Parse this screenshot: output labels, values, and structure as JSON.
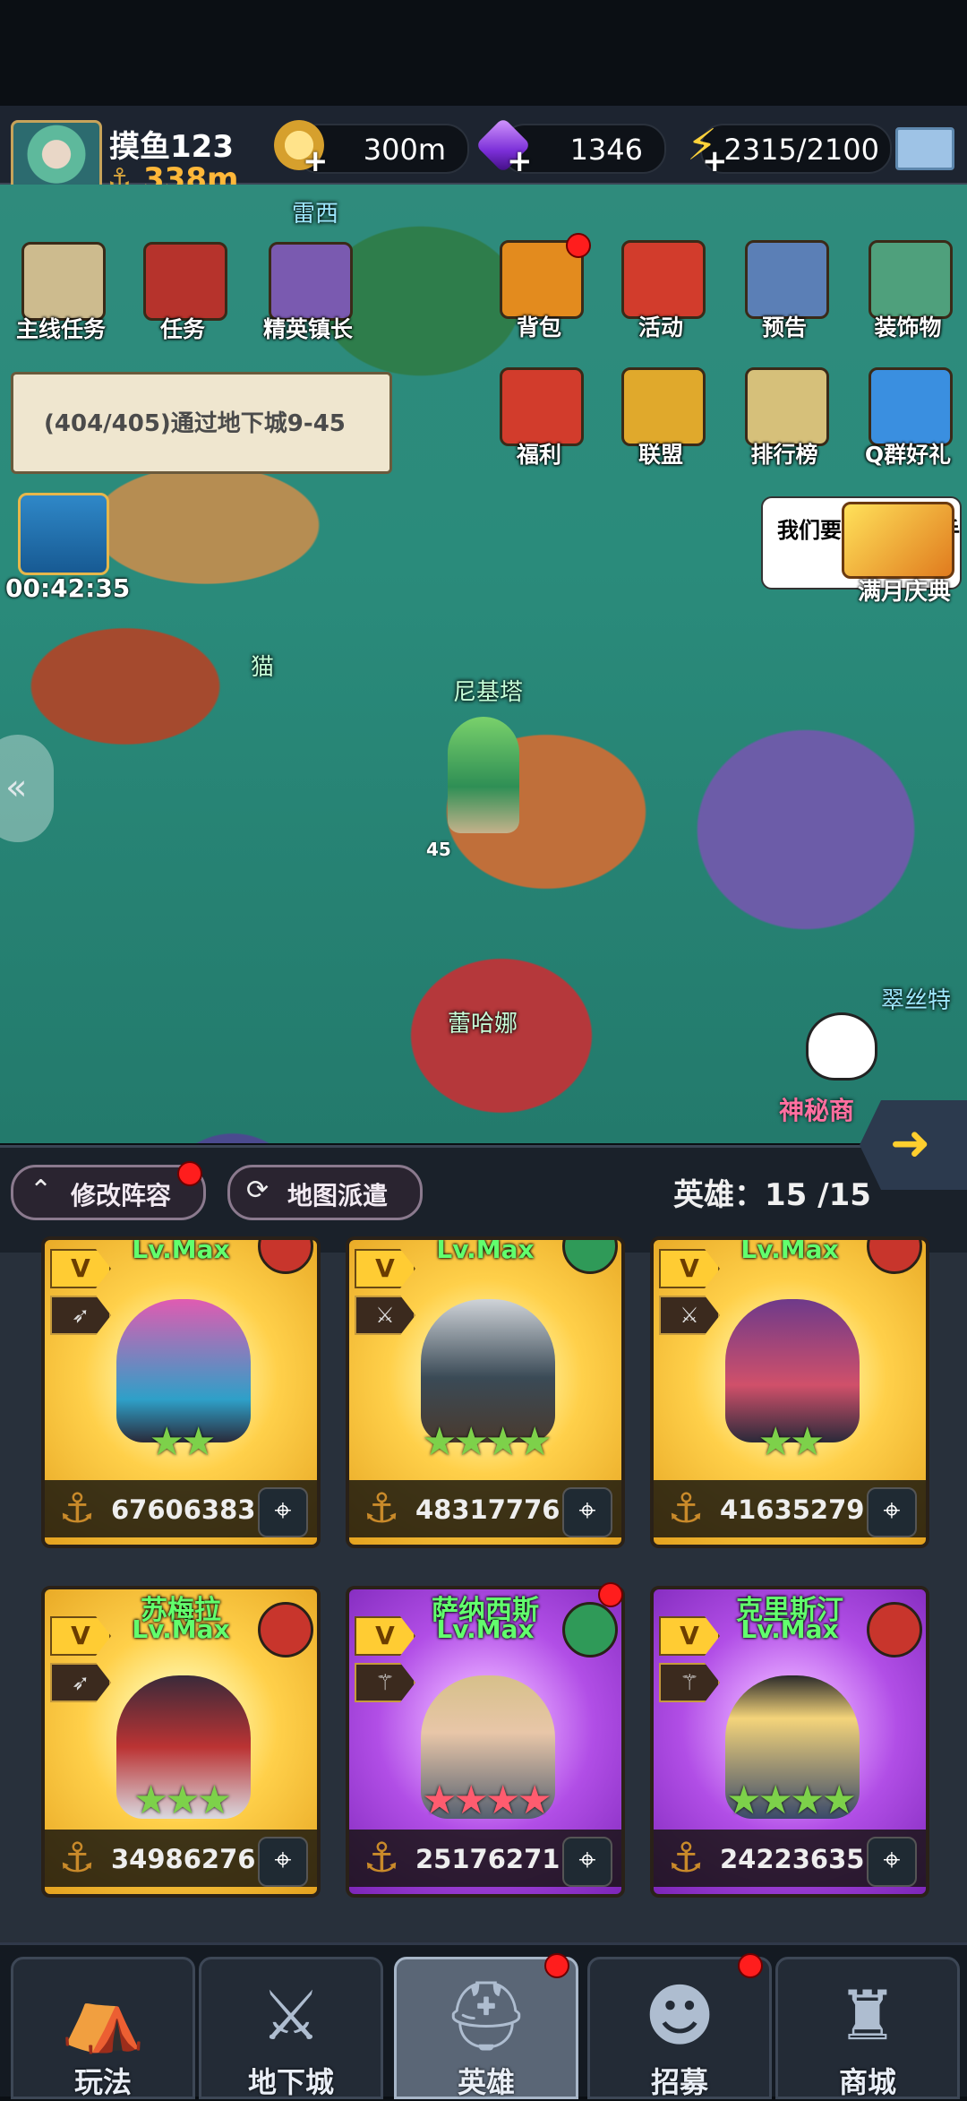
{
  "player": {
    "name": "摸鱼123",
    "power": "338m"
  },
  "resources": {
    "gold": "300m",
    "gems": "1346",
    "energy": "2315/2100"
  },
  "map": {
    "labels": {
      "top_area": "雷西",
      "cat": "猫",
      "nikita": "尼基塔",
      "leihana": "蕾哈娜",
      "cuisite": "翠丝特",
      "level_marker": "45",
      "mystic_shop": "神秘商"
    },
    "left_buttons": [
      {
        "label": "主线任务",
        "icon": "scroll-icon",
        "color": "#cdbb8e"
      },
      {
        "label": "任务",
        "icon": "book-icon",
        "color": "#b6332c"
      },
      {
        "label": "精英镇长",
        "icon": "mayor-icon",
        "color": "#7a5ab0"
      }
    ],
    "right_buttons_row1": [
      {
        "label": "背包",
        "icon": "backpack-icon",
        "color": "#e38b1e",
        "badge": true
      },
      {
        "label": "活动",
        "icon": "shield-icon",
        "color": "#d23c2c",
        "badge": false
      },
      {
        "label": "预告",
        "icon": "open-book-icon",
        "color": "#5b7fb6",
        "badge": false
      },
      {
        "label": "装饰物",
        "icon": "flower-icon",
        "color": "#4fa07c",
        "badge": false
      }
    ],
    "right_buttons_row2": [
      {
        "label": "福利",
        "icon": "gift-shield-icon",
        "color": "#d23c2c"
      },
      {
        "label": "联盟",
        "icon": "fist-icon",
        "color": "#e0a92c"
      },
      {
        "label": "排行榜",
        "icon": "trophy-icon",
        "color": "#d6c07a"
      },
      {
        "label": "Q群好礼",
        "icon": "chat-gift-icon",
        "color": "#3a8fe0"
      }
    ],
    "quest_text": "(404/405)通过地下城9-45",
    "chest_timer": "00:42:35",
    "speech_bubble": "我们要法",
    "bubble_tail": "手",
    "event_label": "满月庆典"
  },
  "midbar": {
    "edit_lineup": "修改阵容",
    "map_dispatch": "地图派遣",
    "hero_count": "英雄：15 /15"
  },
  "heroes": [
    {
      "name": "",
      "level": "Lv.Max",
      "power": "67606383",
      "rarity": "gold",
      "class": "bow",
      "element_color": "#c8352c",
      "art_color": "#e05bb1",
      "stars": "★★",
      "star_color": "#7dd14a"
    },
    {
      "name": "",
      "level": "Lv.Max",
      "power": "48317776",
      "rarity": "gold",
      "class": "sword",
      "element_color": "#2f9a58",
      "art_color": "#3a4a56",
      "stars": "★★★★",
      "star_color": "#7dd14a"
    },
    {
      "name": "",
      "level": "Lv.Max",
      "power": "41635279",
      "rarity": "gold",
      "class": "sword",
      "element_color": "#c8352c",
      "art_color": "#6e3a8a",
      "stars": "★★",
      "star_color": "#7dd14a"
    },
    {
      "name": "苏梅拉",
      "level": "Lv.Max",
      "power": "34986276",
      "rarity": "gold",
      "class": "bow",
      "element_color": "#c8352c",
      "art_color": "#3a2a3a",
      "stars": "★★★",
      "star_color": "#7dd14a"
    },
    {
      "name": "萨纳西斯",
      "level": "Lv.Max",
      "power": "25176271",
      "rarity": "purple",
      "class": "staff",
      "element_color": "#2f9a58",
      "art_color": "#d6c08a",
      "stars": "★★★★",
      "star_color": "#ff5c6f"
    },
    {
      "name": "克里斯汀",
      "level": "Lv.Max",
      "power": "24223635",
      "rarity": "purple",
      "class": "staff",
      "element_color": "#c8352c",
      "art_color": "#f4d47a",
      "stars": "★★★★",
      "star_color": "#7dd14a"
    }
  ],
  "nav": [
    {
      "label": "玩法",
      "icon": "play-icon"
    },
    {
      "label": "地下城",
      "icon": "dungeon-icon"
    },
    {
      "label": "英雄",
      "icon": "hero-helmet-icon"
    },
    {
      "label": "招募",
      "icon": "recruit-icon"
    },
    {
      "label": "商城",
      "icon": "shop-castle-icon"
    }
  ]
}
